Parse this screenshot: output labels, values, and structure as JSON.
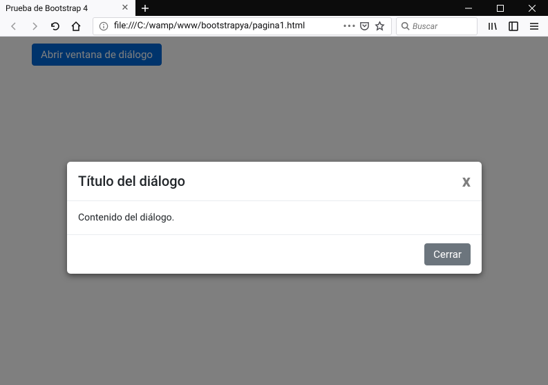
{
  "window": {
    "tab_title": "Prueba de Bootstrap 4"
  },
  "toolbar": {
    "url": "file:///C:/wamp/www/bootstrapya/pagina1.html",
    "search_placeholder": "Buscar"
  },
  "page": {
    "open_button_label": "Abrir ventana de diálogo"
  },
  "modal": {
    "title": "Título del diálogo",
    "body": "Contenido del diálogo.",
    "close_x": "x",
    "close_button_label": "Cerrar"
  }
}
